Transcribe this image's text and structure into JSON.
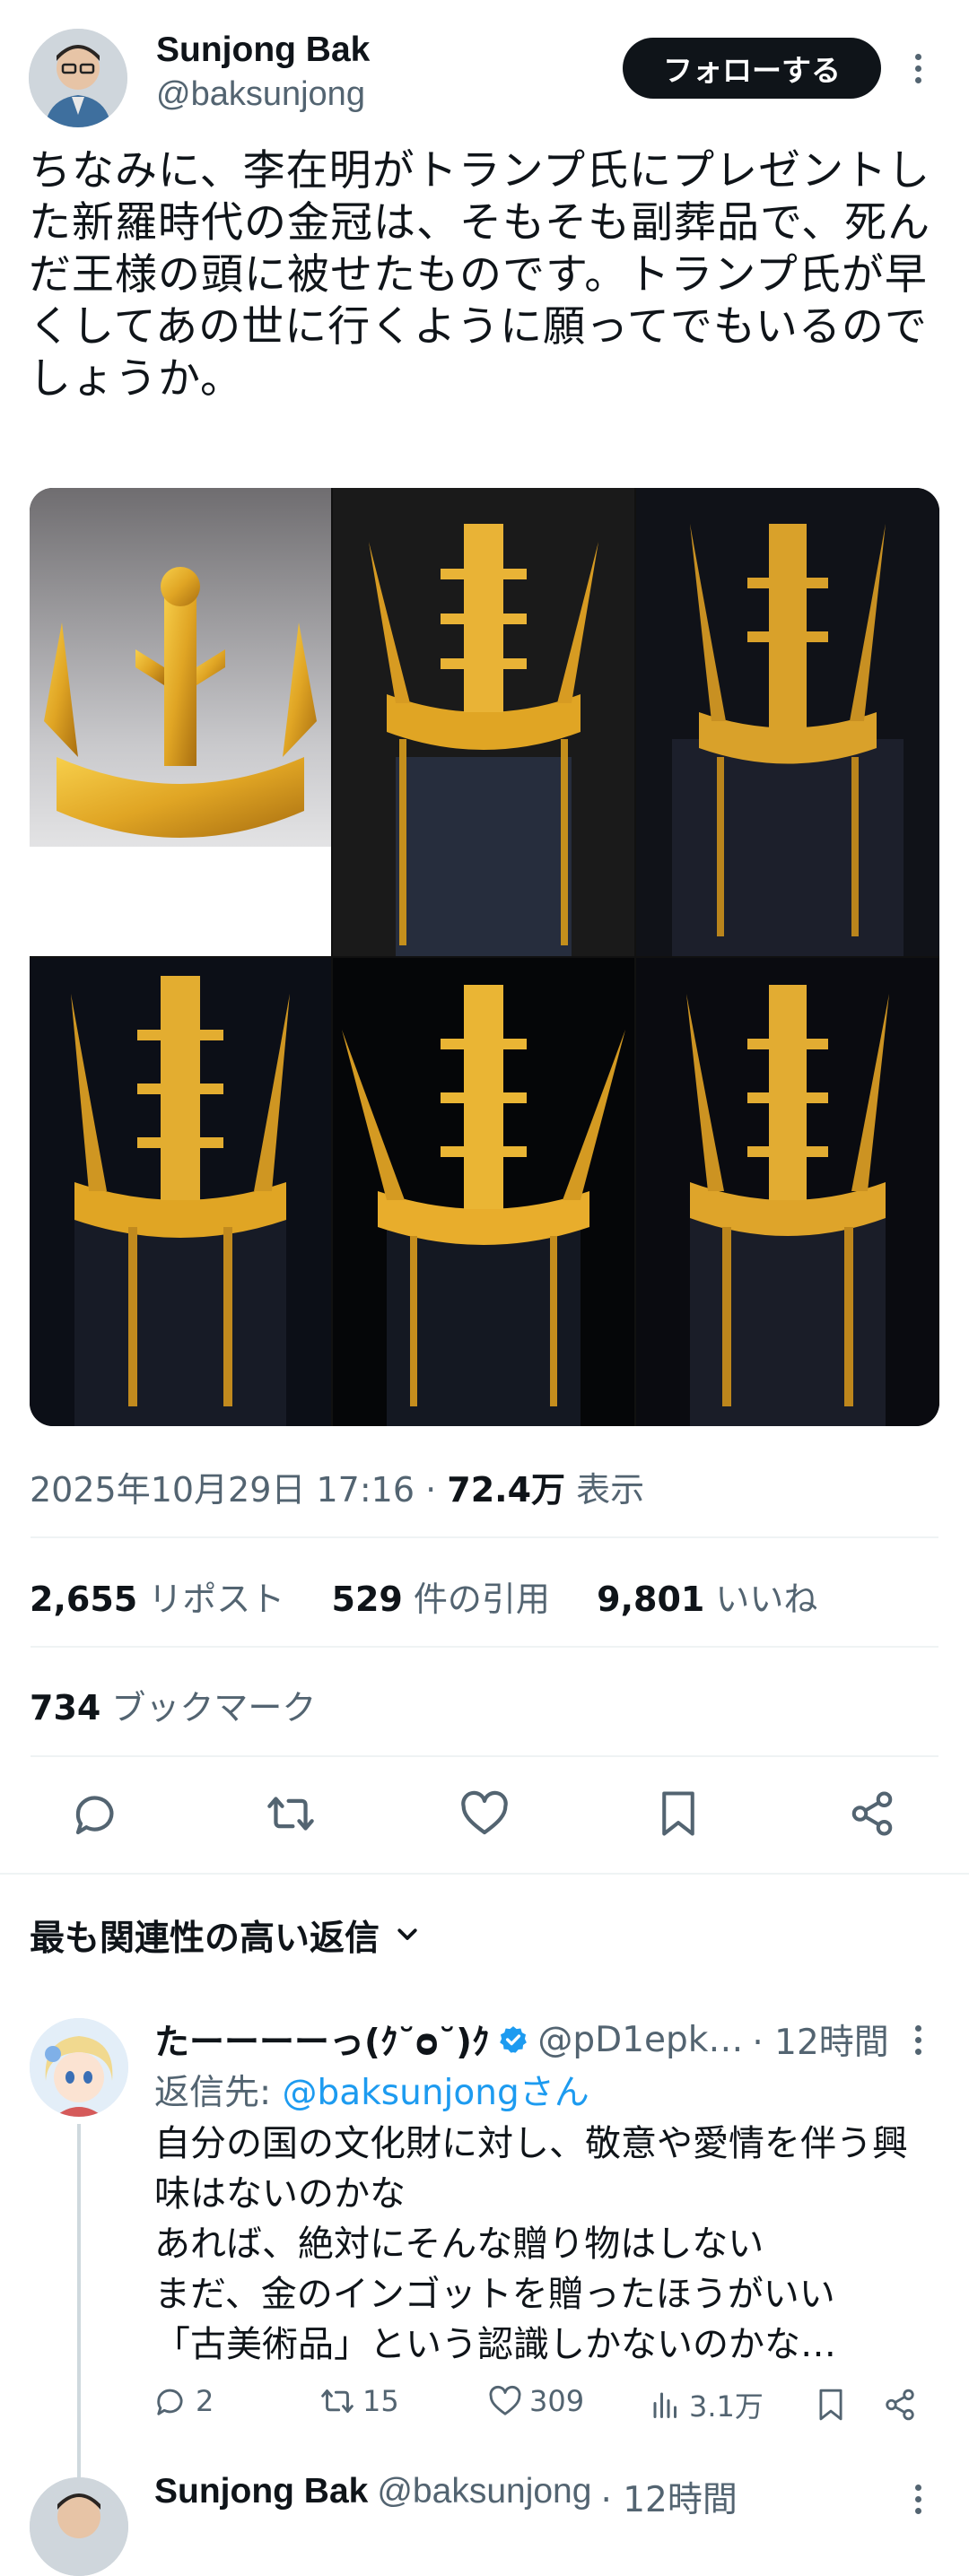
{
  "author": {
    "name": "Sunjong Bak",
    "handle": "@baksunjong",
    "follow_label": "フォローする"
  },
  "post": {
    "text": "ちなみに、李在明がトランプ氏にプレゼントした新羅時代の金冠は、そもそも副葬品で、死んだ王様の頭に被せたものです。トランプ氏が早くしてあの世に行くように願ってでもいるのでしょうか。",
    "image_count": 6,
    "timestamp": "2025年10月29日 17:16",
    "views_value": "72.4万",
    "views_label": "表示"
  },
  "stats": {
    "reposts_value": "2,655",
    "reposts_label": "リポスト",
    "quotes_value": "529",
    "quotes_label": "件の引用",
    "likes_value": "9,801",
    "likes_label": "いいね",
    "bookmarks_value": "734",
    "bookmarks_label": "ブックマーク"
  },
  "actions": [
    "reply-icon",
    "repost-icon",
    "like-icon",
    "bookmark-icon",
    "share-icon"
  ],
  "replies_header": {
    "label": "最も関連性の高い返信"
  },
  "reply": {
    "name": "たーーーーっ(ｸ˘ᴑ˘)ｸ",
    "handle": "@pD1epk…",
    "time": "· 12時間",
    "reply_to_prefix": "返信先: ",
    "reply_to_handle": "@baksunjong",
    "reply_to_suffix": "さん",
    "lines": [
      "自分の国の文化財に対し、敬意や愛情を伴う興味はないのかな",
      "あれば、絶対にそんな贈り物はしない",
      "まだ、金のインゴットを贈ったほうがいい",
      "「古美術品」という認識しかないのかな…"
    ],
    "replies": "2",
    "reposts": "15",
    "likes": "309",
    "views": "3.1万"
  },
  "next_reply": {
    "name": "Sunjong Bak",
    "handle": "@baksunjong",
    "time": "· 12時間"
  },
  "colors": {
    "accent": "#1d9bf0",
    "text": "#0f1419",
    "muted": "#536471",
    "divider": "#eff3f4",
    "gold": "#e0a524"
  }
}
